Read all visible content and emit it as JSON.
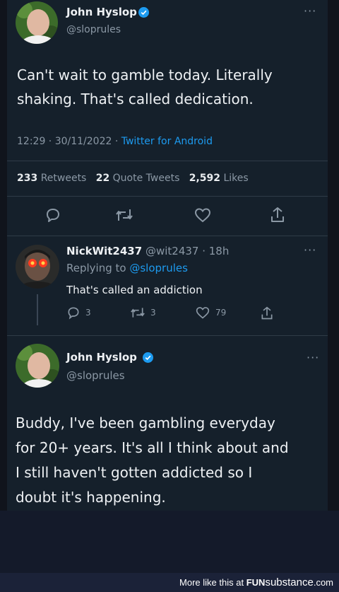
{
  "tweet1": {
    "name": "John Hyslop",
    "handle": "@sloprules",
    "text_line1": "Can't wait to gamble today. Literally",
    "text_line2": "shaking. That's called dedication.",
    "time": "12:29 · 30/11/2022 ·",
    "source": "Twitter for Android",
    "retweets_count": "233",
    "retweets_label": "Retweets",
    "quotes_count": "22",
    "quotes_label": "Quote Tweets",
    "likes_count": "2,592",
    "likes_label": "Likes"
  },
  "reply": {
    "name": "NickWit2437",
    "handle_time": "@wit2437 · 18h",
    "replying_label": "Replying to",
    "replying_handle": "@sloprules",
    "text": "That's called an addiction",
    "reply_count": "3",
    "retweet_count": "3",
    "like_count": "79"
  },
  "tweet2": {
    "name": "John Hyslop",
    "handle": "@sloprules",
    "text_line1": "Buddy, I've been gambling everyday",
    "text_line2": "for 20+ years. It's all I think about and",
    "text_line3": "I still haven't gotten addicted so I",
    "text_line4": "doubt it's happening."
  },
  "footer": {
    "prefix": "More like this at",
    "brand_bold": "FUN",
    "brand_rest": "substance",
    "brand_tld": ".com"
  },
  "colors": {
    "background": "#15202b",
    "accent": "#1d9bf0",
    "text": "#eef1f4",
    "muted": "#8b98a5"
  },
  "icons": [
    "verified-icon",
    "more-icon",
    "reply-icon",
    "retweet-icon",
    "like-icon",
    "share-icon"
  ]
}
